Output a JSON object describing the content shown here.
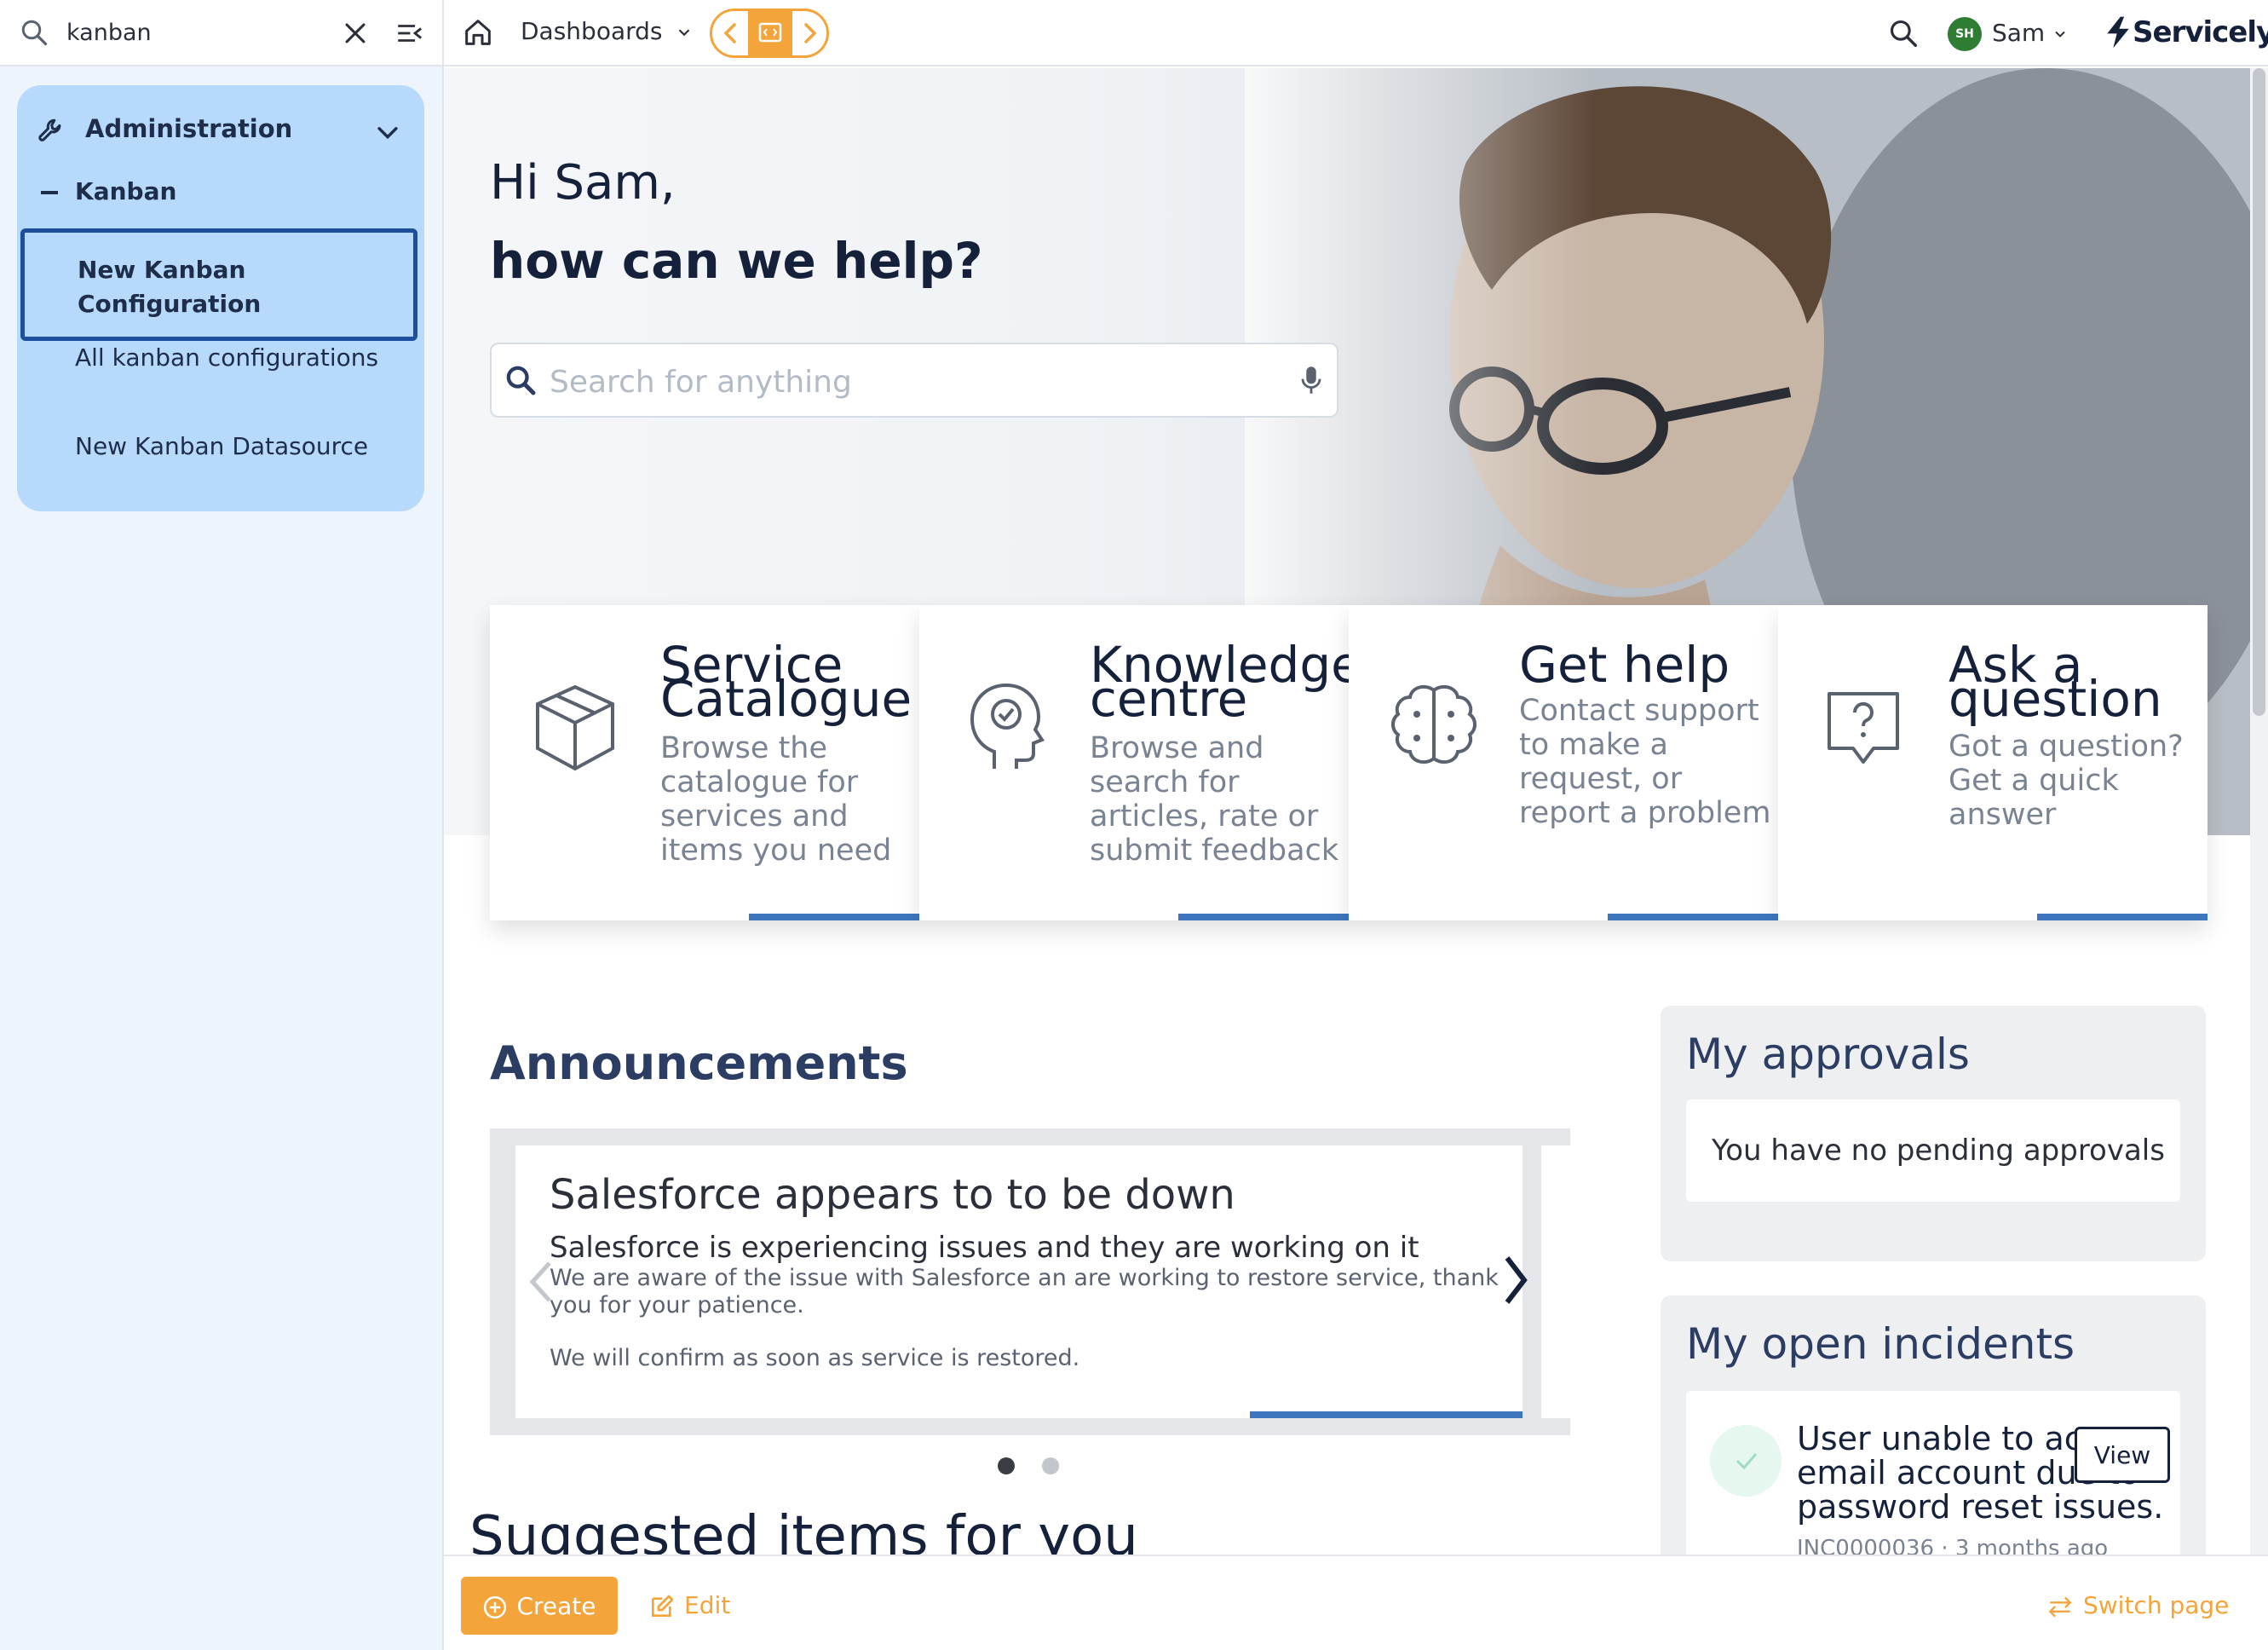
{
  "filter": {
    "value": "kanban",
    "placeholder": ""
  },
  "nav": {
    "section": "Administration",
    "group": "Kanban",
    "items": [
      {
        "label": "New Kanban Configuration",
        "selected": true
      },
      {
        "label": "All kanban configurations",
        "selected": false
      },
      {
        "label": "New Kanban Datasource",
        "selected": false
      }
    ]
  },
  "topbar": {
    "dashboards_label": "Dashboards",
    "user_initials": "SH",
    "user_name": "Sam",
    "brand": "Servicely",
    "accent": "#f3a43b"
  },
  "hero": {
    "greeting": "Hi Sam,",
    "headline": "how can we help?",
    "search_placeholder": "Search for anything"
  },
  "tiles": [
    {
      "title": "Service Catalogue",
      "desc": "Browse the catalogue for services and items you need",
      "icon": "box-icon"
    },
    {
      "title": "Knowledge centre",
      "desc": "Browse and search for articles, rate or submit feedback",
      "icon": "head-check-icon"
    },
    {
      "title": "Get help",
      "desc": "Contact support to make a request, or report a problem",
      "icon": "brain-icon"
    },
    {
      "title": "Ask a question",
      "desc": "Got a question? Get a quick answer",
      "icon": "question-bubble-icon"
    }
  ],
  "announcements": {
    "title": "Announcements",
    "card": {
      "heading": "Salesforce appears to to be down",
      "subheading": "Salesforce is experiencing issues and they are working on it",
      "body1": "We are aware of the issue with Salesforce an are working to restore service, thank you for your patience.",
      "body2": "We will confirm as soon as service is restored."
    },
    "pages": 2,
    "current_page": 1
  },
  "suggested_title": "Suggested items for you",
  "approvals": {
    "title": "My approvals",
    "empty": "You have no pending approvals"
  },
  "incidents": {
    "title": "My open incidents",
    "item": {
      "text": "User unable to access email account due to password reset issues.",
      "meta": "INC0000036 · 3 months ago",
      "view_label": "View"
    }
  },
  "bottombar": {
    "create_label": "Create",
    "edit_label": "Edit",
    "switch_label": "Switch page"
  },
  "colors": {
    "primary_blue": "#3d76bf",
    "nav_card": "#b7dafc",
    "accent": "#f3a43b",
    "avatar": "#2f7d32"
  }
}
